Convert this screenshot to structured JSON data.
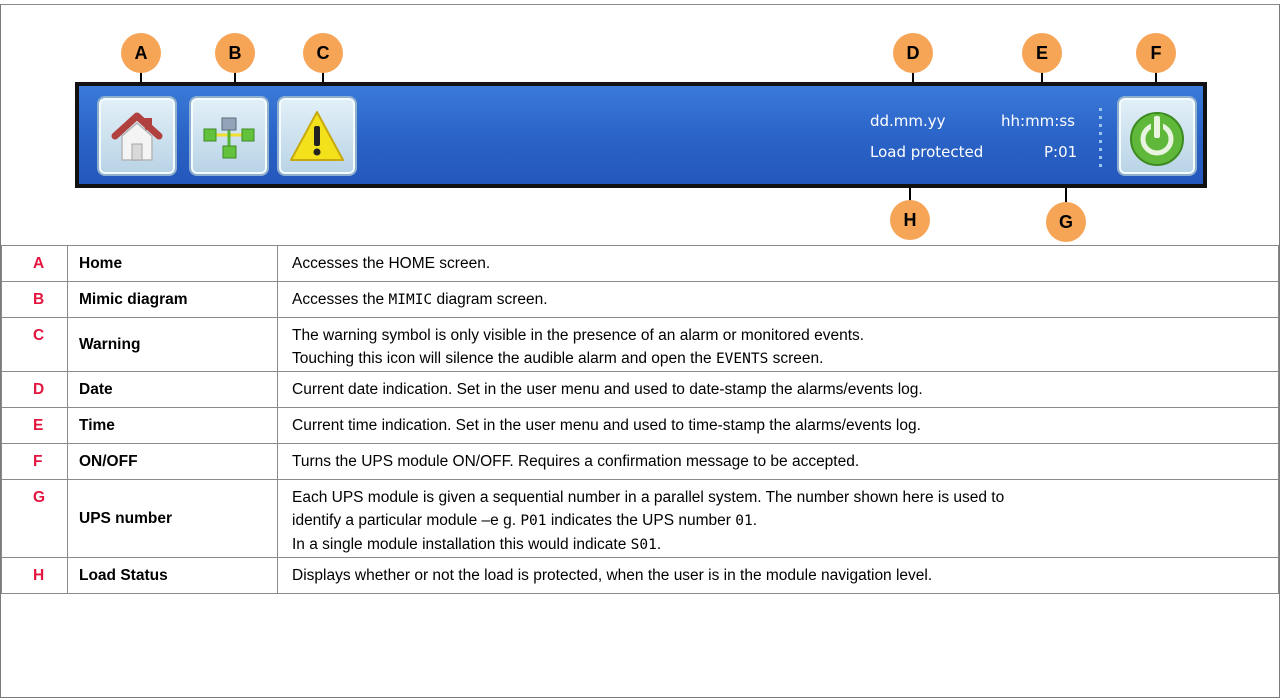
{
  "callouts": [
    "A",
    "B",
    "C",
    "D",
    "E",
    "F",
    "G",
    "H"
  ],
  "bar": {
    "date": "dd.mm.yy",
    "time": "hh:mm:ss",
    "load_status": "Load protected",
    "ups_number": "P:01"
  },
  "icons": {
    "home": "home-icon",
    "mimic": "mimic-diagram-icon",
    "warning": "warning-icon",
    "power": "power-icon"
  },
  "colors": {
    "bar": "#2a62c6",
    "callout": "#f6a456",
    "letter": "#e4153e",
    "power": "#5fb83a",
    "warning": "#f3e11c"
  },
  "rows": [
    {
      "letter": "A",
      "name": "Home",
      "desc": [
        [
          "Accesses the HOME screen."
        ]
      ]
    },
    {
      "letter": "B",
      "name": "Mimic diagram",
      "desc": [
        [
          "Accesses the ",
          "MIMIC",
          " diagram screen."
        ]
      ]
    },
    {
      "letter": "C",
      "name": "Warning",
      "desc": [
        [
          "The warning symbol is only visible in the presence of an alarm or monitored events."
        ],
        [
          "Touching this icon will silence the audible alarm and open the ",
          "EVENTS",
          " screen."
        ]
      ]
    },
    {
      "letter": "D",
      "name": "Date",
      "desc": [
        [
          "Current date indication. Set in the user menu and used to date-stamp the alarms/events log."
        ]
      ]
    },
    {
      "letter": "E",
      "name": "Time",
      "desc": [
        [
          "Current time indication. Set in the user menu and used to time-stamp the alarms/events log."
        ]
      ]
    },
    {
      "letter": "F",
      "name": "ON/OFF",
      "desc": [
        [
          "Turns the UPS module ON/OFF. Requires a confirmation message to be accepted."
        ]
      ]
    },
    {
      "letter": "G",
      "name": "UPS number",
      "desc": [
        [
          "Each UPS module is given a sequential number in a parallel system. The number shown here is used to"
        ],
        [
          "identify a particular module –e g. ",
          "P01",
          " indicates the UPS number ",
          "01",
          "."
        ],
        [
          "In a single module installation this would indicate ",
          "S01",
          "."
        ]
      ]
    },
    {
      "letter": "H",
      "name": "Load Status",
      "desc": [
        [
          "Displays whether or not the load is protected, when the user is in the module navigation level."
        ]
      ]
    }
  ]
}
